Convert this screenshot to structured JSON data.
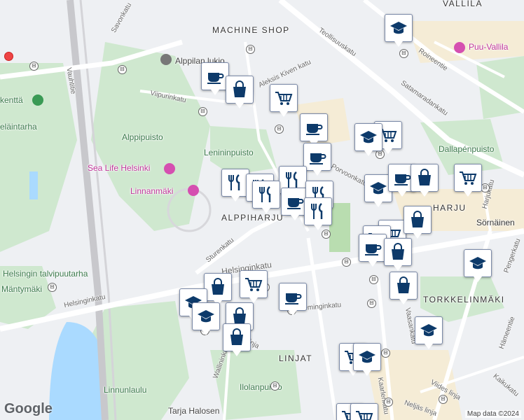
{
  "map": {
    "district_labels": [
      "VALLILA",
      "MACHINE SHOP",
      "ALPPIHARJU",
      "HARJU",
      "TORKKELINMÄKI",
      "LINJAT"
    ],
    "park_labels": [
      "Alppipuisto",
      "Lenininpuisto",
      "Dallapénpuisto",
      "Helsingin talvipuutarha",
      "Mäntymäki",
      "Linnunlaulu",
      "Ilolanpuisto",
      "eläintarha",
      "kenttä"
    ],
    "poi_labels": [
      "Sea Life Helsinki",
      "Linnanmäki",
      "Puu-Vallila",
      "Alppilan lukio",
      "Tarja Halosen"
    ],
    "street_labels": [
      "Teollisuuskatu",
      "Savonkatu",
      "Vauhtitie",
      "Aleksis Kiven katu",
      "Viipurinkatu",
      "Satamaradankatu",
      "Roineentie",
      "Porvoonkatu",
      "Harjukatu",
      "Sturenkatu",
      "Helsinginkatu",
      "Pengerkatu",
      "Hämeentie",
      "Kaikukatu",
      "Viides linja",
      "Neljäs linja",
      "Wallininkatu",
      "Fleminginkatu",
      "Vaasankatu",
      "Sörnäinen",
      "Aleksis Kiven katu",
      "linja",
      "imas linja",
      "vaa",
      "Kaarlenkatu"
    ]
  },
  "footer": {
    "logo": "Google",
    "attribution": "Map data ©2024"
  },
  "pins": [
    {
      "type": "school"
    },
    {
      "type": "cafe"
    },
    {
      "type": "shop"
    },
    {
      "type": "cart"
    },
    {
      "type": "cafe"
    },
    {
      "type": "cart"
    },
    {
      "type": "school"
    },
    {
      "type": "cafe"
    },
    {
      "type": "food"
    },
    {
      "type": "food"
    },
    {
      "type": "food"
    },
    {
      "type": "food"
    },
    {
      "type": "cafe"
    },
    {
      "type": "food"
    },
    {
      "type": "food"
    },
    {
      "type": "school"
    },
    {
      "type": "cart"
    },
    {
      "type": "cafe"
    },
    {
      "type": "shop"
    },
    {
      "type": "cart"
    },
    {
      "type": "shop"
    },
    {
      "type": "cart"
    },
    {
      "type": "cafe"
    },
    {
      "type": "shop"
    },
    {
      "type": "school"
    },
    {
      "type": "shop"
    },
    {
      "type": "school"
    },
    {
      "type": "cart"
    },
    {
      "type": "cafe"
    },
    {
      "type": "school"
    },
    {
      "type": "shop"
    },
    {
      "type": "shop"
    },
    {
      "type": "shop"
    },
    {
      "type": "cart"
    },
    {
      "type": "school"
    },
    {
      "type": "school"
    },
    {
      "type": "cart"
    },
    {
      "type": "cart"
    }
  ]
}
